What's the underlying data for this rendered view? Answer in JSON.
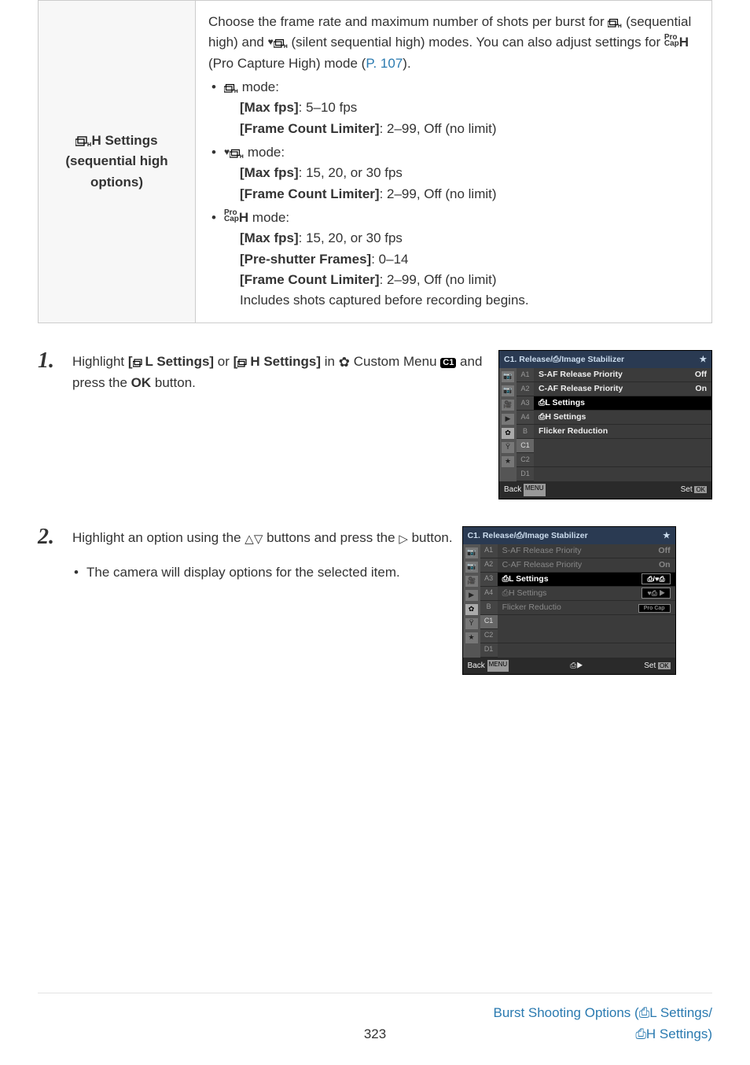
{
  "table": {
    "label_prefix_icon": "burst",
    "label_line1_suffix": "H Settings",
    "label_line2": "(sequential high",
    "label_line3": "options)",
    "intro_p1a": "Choose the frame rate and maximum number of shots per burst for ",
    "intro_p1b": " (sequential high) and ",
    "intro_p1c": " (silent sequential high) modes. You can also adjust settings for ",
    "intro_p1d": " (Pro Capture High) mode (",
    "link_p107": "P. 107",
    "intro_p1e": ").",
    "mode1_label": " mode:",
    "mode1_maxfps_label": "[Max fps]",
    "mode1_maxfps_val": ": 5–10 fps",
    "mode1_fcl_label": "[Frame Count Limiter]",
    "mode1_fcl_val": ": 2–99, Off (no limit)",
    "mode2_label": " mode:",
    "mode2_maxfps_label": "[Max fps]",
    "mode2_maxfps_val": ": 15, 20, or 30 fps",
    "mode2_fcl_label": "[Frame Count Limiter]",
    "mode2_fcl_val": ": 2–99, Off (no limit)",
    "mode3_label": " mode:",
    "mode3_maxfps_label": "[Max fps]",
    "mode3_maxfps_val": ": 15, 20, or 30 fps",
    "mode3_pre_label": "[Pre-shutter Frames]",
    "mode3_pre_val": ": 0–14",
    "mode3_fcl_label": "[Frame Count Limiter]",
    "mode3_fcl_val": ": 2–99, Off (no limit)",
    "mode3_note": "Includes shots captured before recording begins."
  },
  "step1": {
    "num": "1.",
    "a": "Highlight ",
    "opt1_prefix": "[",
    "opt1_suffix": "L Settings]",
    "b": " or ",
    "opt2_prefix": "[",
    "opt2_suffix": "H Settings]",
    "c": " in ",
    "d": " Custom Menu ",
    "c1": "C1",
    "e": " and press the ",
    "ok": "OK",
    "f": " button."
  },
  "step2": {
    "num": "2.",
    "a": "Highlight an option using the ",
    "b": " buttons and press the ",
    "c": " button.",
    "sub": "The camera will display options for the selected item."
  },
  "screen1": {
    "title": "C1. Release/⎙/Image Stabilizer",
    "tabs_left": [
      "A1",
      "A2",
      "A3",
      "A4",
      "B",
      "C1",
      "C2",
      "D1"
    ],
    "rows": [
      {
        "label": "S-AF Release Priority",
        "val": "Off",
        "dis": false,
        "sel": false
      },
      {
        "label": "C-AF Release Priority",
        "val": "On",
        "dis": false,
        "sel": false
      },
      {
        "label": "⎙L Settings",
        "val": "",
        "dis": false,
        "sel": true
      },
      {
        "label": "⎙H Settings",
        "val": "",
        "dis": false,
        "sel": false
      },
      {
        "label": "Flicker Reduction",
        "val": "",
        "dis": false,
        "sel": false
      }
    ],
    "back": "Back",
    "back_btn": "MENU",
    "set": "Set",
    "set_btn": "OK"
  },
  "screen2": {
    "title": "C1. Release/⎙/Image Stabilizer",
    "tabs_left": [
      "A1",
      "A2",
      "A3",
      "A4",
      "B",
      "C1",
      "C2",
      "D1"
    ],
    "rows": [
      {
        "label": "S-AF Release Priority",
        "val": "Off",
        "dis": true,
        "sel": false,
        "popup": ""
      },
      {
        "label": "C-AF Release Priority",
        "val": "On",
        "dis": true,
        "sel": false,
        "popup": ""
      },
      {
        "label": "⎙L Settings",
        "val": "",
        "dis": false,
        "sel": true,
        "popup": "⎙/♥⎙"
      },
      {
        "label": "⎙H Settings",
        "val": "",
        "dis": true,
        "sel": false,
        "popup": "♥⎙  ▶"
      },
      {
        "label": "Flicker Reductio",
        "val": "",
        "dis": true,
        "sel": false,
        "popup": "Pro Cap"
      }
    ],
    "back": "Back",
    "back_btn": "MENU",
    "mid": "⎙▶",
    "set": "Set",
    "set_btn": "OK"
  },
  "footer": {
    "page": "323",
    "link_l1": "Burst Shooting Options (⎙L Settings/",
    "link_l2": "⎙H Settings)"
  }
}
